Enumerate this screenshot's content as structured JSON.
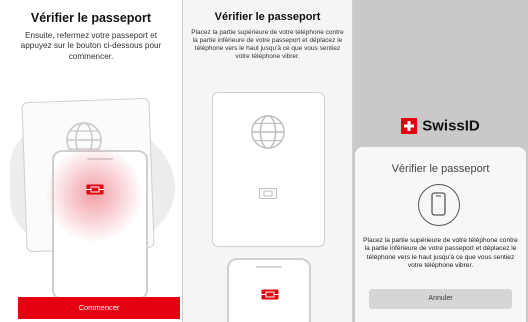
{
  "panels": [
    {
      "title": "Vérifier le passeport",
      "description": "Ensuite, refermez votre passeport et appuyez sur le bouton ci-dessous pour commencer.",
      "button_label": "Commencer"
    },
    {
      "title": "Vérifier le passeport",
      "description": "Placez la partie supérieure de votre téléphone contre la partie inférieure de votre passeport et déplacez le téléphone vers le haut jusqu'à ce que vous sentiez votre téléphone vibrer."
    },
    {
      "brand": "SwissID",
      "sheet_title": "Vérifier le passeport",
      "sheet_description": "Placez la partie supérieure de votre téléphone contre la partie inférieure de votre passeport et déplacez le téléphone vers le haut jusqu'à ce que vous sentiez votre téléphone vibrer.",
      "cancel_label": "Annuler"
    }
  ],
  "colors": {
    "accent": "#e3000f",
    "panel_bg": "#ffffff",
    "overlay_bg": "#c9c9c9"
  },
  "icons": [
    "globe-icon",
    "passport-chip-icon",
    "phone-icon",
    "swiss-cross-icon"
  ]
}
